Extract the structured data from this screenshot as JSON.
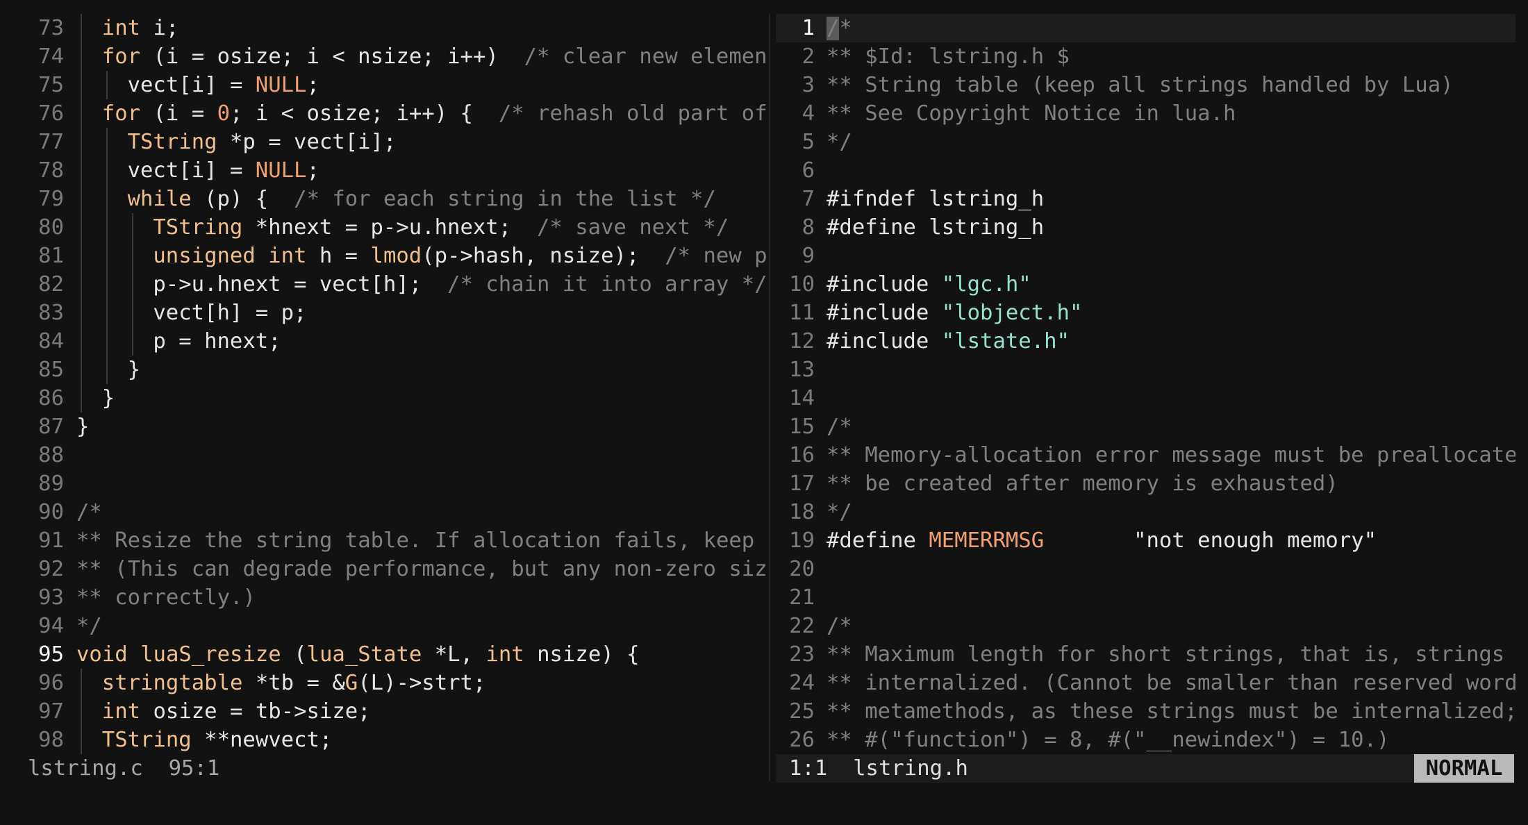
{
  "colors": {
    "background": "#121212",
    "text": "#e6e6e6",
    "keyword": "#f0c08a",
    "comment": "#808080",
    "number": "#f0a070",
    "string": "#93e3cf",
    "line_number": "#7a7a7a",
    "mode_badge_bg": "#b9b9b9"
  },
  "left_pane": {
    "file": "lstring.c",
    "cursor_line": 95,
    "lines": [
      {
        "n": "73",
        "indent": 1,
        "tokens": [
          [
            "int",
            "t-type"
          ],
          [
            " i;",
            "t-plain"
          ]
        ]
      },
      {
        "n": "74",
        "indent": 1,
        "tokens": [
          [
            "for",
            "t-keyword"
          ],
          [
            " (i = osize; i < nsize; i++)  ",
            "t-plain"
          ],
          [
            "/* clear new elements */",
            "t-comment"
          ]
        ]
      },
      {
        "n": "75",
        "indent": 2,
        "tokens": [
          [
            "vect[i] = ",
            "t-plain"
          ],
          [
            "NULL",
            "t-macro"
          ],
          [
            ";",
            "t-plain"
          ]
        ]
      },
      {
        "n": "76",
        "indent": 1,
        "tokens": [
          [
            "for",
            "t-keyword"
          ],
          [
            " (i = ",
            "t-plain"
          ],
          [
            "0",
            "t-number"
          ],
          [
            "; i < osize; i++) {  ",
            "t-plain"
          ],
          [
            "/* rehash old part of the array */",
            "t-comment"
          ]
        ]
      },
      {
        "n": "77",
        "indent": 2,
        "tokens": [
          [
            "TString",
            "t-type"
          ],
          [
            " *p = vect[i];",
            "t-plain"
          ]
        ]
      },
      {
        "n": "78",
        "indent": 2,
        "tokens": [
          [
            "vect[i] = ",
            "t-plain"
          ],
          [
            "NULL",
            "t-macro"
          ],
          [
            ";",
            "t-plain"
          ]
        ]
      },
      {
        "n": "79",
        "indent": 2,
        "tokens": [
          [
            "while",
            "t-keyword"
          ],
          [
            " (p) {  ",
            "t-plain"
          ],
          [
            "/* for each string in the list */",
            "t-comment"
          ]
        ]
      },
      {
        "n": "80",
        "indent": 3,
        "tokens": [
          [
            "TString",
            "t-type"
          ],
          [
            " *hnext = p->u.hnext;  ",
            "t-plain"
          ],
          [
            "/* save next */",
            "t-comment"
          ]
        ]
      },
      {
        "n": "81",
        "indent": 3,
        "tokens": [
          [
            "unsigned int",
            "t-type"
          ],
          [
            " h = ",
            "t-plain"
          ],
          [
            "lmod",
            "t-fn"
          ],
          [
            "(p->hash, nsize);  ",
            "t-plain"
          ],
          [
            "/* new position */",
            "t-comment"
          ]
        ]
      },
      {
        "n": "82",
        "indent": 3,
        "tokens": [
          [
            "p->u.hnext = vect[h];  ",
            "t-plain"
          ],
          [
            "/* chain it into array */",
            "t-comment"
          ]
        ]
      },
      {
        "n": "83",
        "indent": 3,
        "tokens": [
          [
            "vect[h] = p;",
            "t-plain"
          ]
        ]
      },
      {
        "n": "84",
        "indent": 3,
        "tokens": [
          [
            "p = hnext;",
            "t-plain"
          ]
        ]
      },
      {
        "n": "85",
        "indent": 2,
        "tokens": [
          [
            "}",
            "t-plain"
          ]
        ]
      },
      {
        "n": "86",
        "indent": 1,
        "tokens": [
          [
            "}",
            "t-plain"
          ]
        ]
      },
      {
        "n": "87",
        "indent": 0,
        "tokens": [
          [
            "}",
            "t-plain"
          ]
        ]
      },
      {
        "n": "88",
        "indent": 0,
        "tokens": []
      },
      {
        "n": "89",
        "indent": 0,
        "tokens": []
      },
      {
        "n": "90",
        "indent": 0,
        "tokens": [
          [
            "/*",
            "t-comment"
          ]
        ]
      },
      {
        "n": "91",
        "indent": 0,
        "tokens": [
          [
            "** Resize the string table. If allocation fails, keep the current size.",
            "t-comment"
          ]
        ]
      },
      {
        "n": "92",
        "indent": 0,
        "tokens": [
          [
            "** (This can degrade performance, but any non-zero size should work",
            "t-comment"
          ]
        ]
      },
      {
        "n": "93",
        "indent": 0,
        "tokens": [
          [
            "** correctly.)",
            "t-comment"
          ]
        ]
      },
      {
        "n": "94",
        "indent": 0,
        "tokens": [
          [
            "*/",
            "t-comment"
          ]
        ]
      },
      {
        "n": "95",
        "indent": 0,
        "tokens": [
          [
            "void",
            "t-type"
          ],
          [
            " ",
            "t-plain"
          ],
          [
            "luaS_resize",
            "t-fn"
          ],
          [
            " (",
            "t-plain"
          ],
          [
            "lua_State",
            "t-type"
          ],
          [
            " *L, ",
            "t-plain"
          ],
          [
            "int",
            "t-type"
          ],
          [
            " nsize) {",
            "t-plain"
          ]
        ]
      },
      {
        "n": "96",
        "indent": 1,
        "tokens": [
          [
            "stringtable",
            "t-type"
          ],
          [
            " *tb = &",
            "t-plain"
          ],
          [
            "G",
            "t-fn"
          ],
          [
            "(L)->strt;",
            "t-plain"
          ]
        ]
      },
      {
        "n": "97",
        "indent": 1,
        "tokens": [
          [
            "int",
            "t-type"
          ],
          [
            " osize = tb->size;",
            "t-plain"
          ]
        ]
      },
      {
        "n": "98",
        "indent": 1,
        "tokens": [
          [
            "TString",
            "t-type"
          ],
          [
            " **newvect;",
            "t-plain"
          ]
        ]
      }
    ],
    "status": {
      "file": "lstring.c",
      "position": "95:1"
    }
  },
  "right_pane": {
    "file": "lstring.h",
    "cursor_line": 1,
    "lines": [
      {
        "n": "1",
        "tokens": [
          [
            "/*",
            "t-comment"
          ]
        ]
      },
      {
        "n": "2",
        "tokens": [
          [
            "** $Id: lstring.h $",
            "t-comment"
          ]
        ]
      },
      {
        "n": "3",
        "tokens": [
          [
            "** String table (keep all strings handled by Lua)",
            "t-comment"
          ]
        ]
      },
      {
        "n": "4",
        "tokens": [
          [
            "** See Copyright Notice in lua.h",
            "t-comment"
          ]
        ]
      },
      {
        "n": "5",
        "tokens": [
          [
            "*/",
            "t-comment"
          ]
        ]
      },
      {
        "n": "6",
        "tokens": []
      },
      {
        "n": "7",
        "tokens": [
          [
            "#ifndef",
            "t-plain"
          ],
          [
            " lstring_h",
            "t-plain"
          ]
        ]
      },
      {
        "n": "8",
        "tokens": [
          [
            "#define",
            "t-plain"
          ],
          [
            " lstring_h",
            "t-plain"
          ]
        ]
      },
      {
        "n": "9",
        "tokens": []
      },
      {
        "n": "10",
        "tokens": [
          [
            "#include",
            "t-plain"
          ],
          [
            " ",
            "t-plain"
          ],
          [
            "\"lgc.h\"",
            "t-string"
          ]
        ]
      },
      {
        "n": "11",
        "tokens": [
          [
            "#include",
            "t-plain"
          ],
          [
            " ",
            "t-plain"
          ],
          [
            "\"lobject.h\"",
            "t-string"
          ]
        ]
      },
      {
        "n": "12",
        "tokens": [
          [
            "#include",
            "t-plain"
          ],
          [
            " ",
            "t-plain"
          ],
          [
            "\"lstate.h\"",
            "t-string"
          ]
        ]
      },
      {
        "n": "13",
        "tokens": []
      },
      {
        "n": "14",
        "tokens": []
      },
      {
        "n": "15",
        "tokens": [
          [
            "/*",
            "t-comment"
          ]
        ]
      },
      {
        "n": "16",
        "tokens": [
          [
            "** Memory-allocation error message must be preallocated (it cannot",
            "t-comment"
          ]
        ]
      },
      {
        "n": "17",
        "tokens": [
          [
            "** be created after memory is exhausted)",
            "t-comment"
          ]
        ]
      },
      {
        "n": "18",
        "tokens": [
          [
            "*/",
            "t-comment"
          ]
        ]
      },
      {
        "n": "19",
        "tokens": [
          [
            "#define",
            "t-plain"
          ],
          [
            " ",
            "t-plain"
          ],
          [
            "MEMERRMSG",
            "t-macro"
          ],
          [
            "       \"not enough memory\"",
            "t-plain"
          ]
        ]
      },
      {
        "n": "20",
        "tokens": []
      },
      {
        "n": "21",
        "tokens": []
      },
      {
        "n": "22",
        "tokens": [
          [
            "/*",
            "t-comment"
          ]
        ]
      },
      {
        "n": "23",
        "tokens": [
          [
            "** Maximum length for short strings, that is, strings that are",
            "t-comment"
          ]
        ]
      },
      {
        "n": "24",
        "tokens": [
          [
            "** internalized. (Cannot be smaller than reserved words or tags for",
            "t-comment"
          ]
        ]
      },
      {
        "n": "25",
        "tokens": [
          [
            "** metamethods, as these strings must be internalized;",
            "t-comment"
          ]
        ]
      },
      {
        "n": "26",
        "tokens": [
          [
            "** #(\"function\") = 8, #(\"__newindex\") = 10.)",
            "t-comment"
          ]
        ]
      }
    ],
    "status": {
      "position": "1:1",
      "file": "lstring.h",
      "mode": "NORMAL"
    }
  }
}
